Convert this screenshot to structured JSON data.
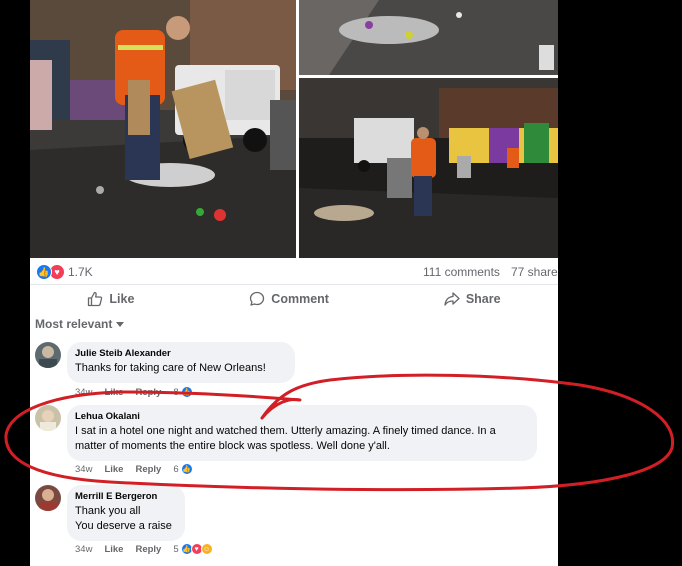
{
  "post": {
    "reactions_count": "1.7K",
    "comments_count": "111 comments",
    "shares_count": "77 shares"
  },
  "actions": {
    "like": "Like",
    "comment": "Comment",
    "share": "Share"
  },
  "sort_label": "Most relevant",
  "comments": [
    {
      "name": "Julie Steib Alexander",
      "text": "Thanks for taking care of New Orleans!",
      "time": "34w",
      "like": "Like",
      "reply": "Reply",
      "reaction_count": "8"
    },
    {
      "name": "Lehua Okalani",
      "text": "I sat in a hotel one night and watched them. Utterly amazing. A finely timed dance. In a matter of moments the entire block was spotless. Well done y'all.",
      "time": "34w",
      "like": "Like",
      "reply": "Reply",
      "reaction_count": "6"
    },
    {
      "name": "Merrill E Bergeron",
      "text_line1": "Thank you all",
      "text_line2": "You deserve a raise",
      "time": "34w",
      "like": "Like",
      "reply": "Reply",
      "reaction_count": "5"
    }
  ],
  "colors": {
    "like_blue": "#1877f2",
    "love_red": "#f33e58",
    "care_yellow": "#f7b125",
    "annotation_red": "#d21f26",
    "bubble_gray": "#f0f2f5"
  },
  "icons": [
    "like-reaction-icon",
    "love-reaction-icon",
    "thumbs-up-icon",
    "comment-icon",
    "share-icon",
    "chevron-down-icon"
  ]
}
